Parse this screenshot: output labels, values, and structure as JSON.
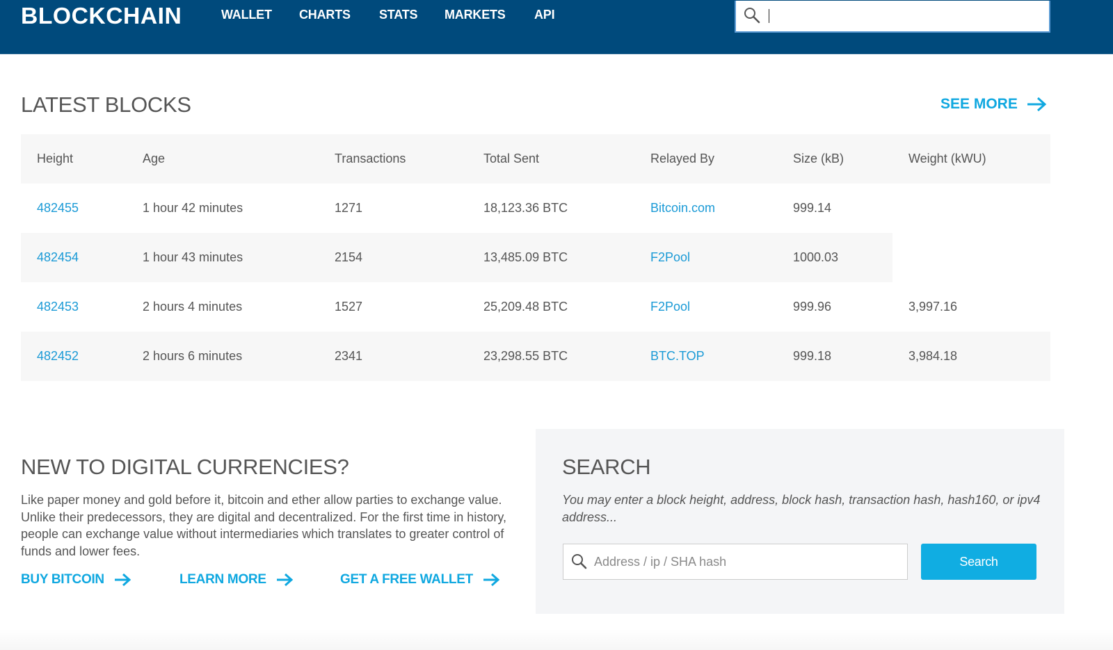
{
  "header": {
    "logo": "BLOCKCHAIN",
    "nav": [
      {
        "label": "WALLET"
      },
      {
        "label": "CHARTS"
      },
      {
        "label": "STATS"
      },
      {
        "label": "MARKETS"
      },
      {
        "label": "API"
      }
    ],
    "search": {
      "value": "",
      "icon": "search-icon"
    }
  },
  "latest_blocks": {
    "title": "LATEST BLOCKS",
    "see_more": "SEE MORE",
    "columns": [
      "Height",
      "Age",
      "Transactions",
      "Total Sent",
      "Relayed By",
      "Size (kB)",
      "Weight (kWU)"
    ],
    "rows": [
      {
        "height": "482455",
        "age": "1 hour 42 minutes",
        "transactions": "1271",
        "total_sent": "18,123.36 BTC",
        "relayed_by": "Bitcoin.com",
        "size": "999.14",
        "weight": ""
      },
      {
        "height": "482454",
        "age": "1 hour 43 minutes",
        "transactions": "2154",
        "total_sent": "13,485.09 BTC",
        "relayed_by": "F2Pool",
        "size": "1000.03",
        "weight": ""
      },
      {
        "height": "482453",
        "age": "2 hours 4 minutes",
        "transactions": "1527",
        "total_sent": "25,209.48 BTC",
        "relayed_by": "F2Pool",
        "size": "999.96",
        "weight": "3,997.16"
      },
      {
        "height": "482452",
        "age": "2 hours 6 minutes",
        "transactions": "2341",
        "total_sent": "23,298.55 BTC",
        "relayed_by": "BTC.TOP",
        "size": "999.18",
        "weight": "3,984.18"
      }
    ]
  },
  "intro": {
    "title": "NEW TO DIGITAL CURRENCIES?",
    "text": "Like paper money and gold before it, bitcoin and ether allow parties to exchange value. Unlike their predecessors, they are digital and decentralized. For the first time in history, people can exchange value without intermediaries which translates to greater control of funds and lower fees.",
    "links": [
      {
        "label": "BUY BITCOIN"
      },
      {
        "label": "LEARN MORE"
      },
      {
        "label": "GET A FREE WALLET"
      }
    ]
  },
  "search_panel": {
    "title": "SEARCH",
    "description": "You may enter a block height, address, block hash, transaction hash, hash160, or ipv4 address...",
    "placeholder": "Address / ip / SHA hash",
    "value": "",
    "button": "Search"
  },
  "colors": {
    "header_bg": "#004a7c",
    "accent": "#10a8e0",
    "link": "#1a9ad6",
    "text": "#555555",
    "row_alt": "#f7f7f7",
    "panel_bg": "#f4f5f7"
  }
}
